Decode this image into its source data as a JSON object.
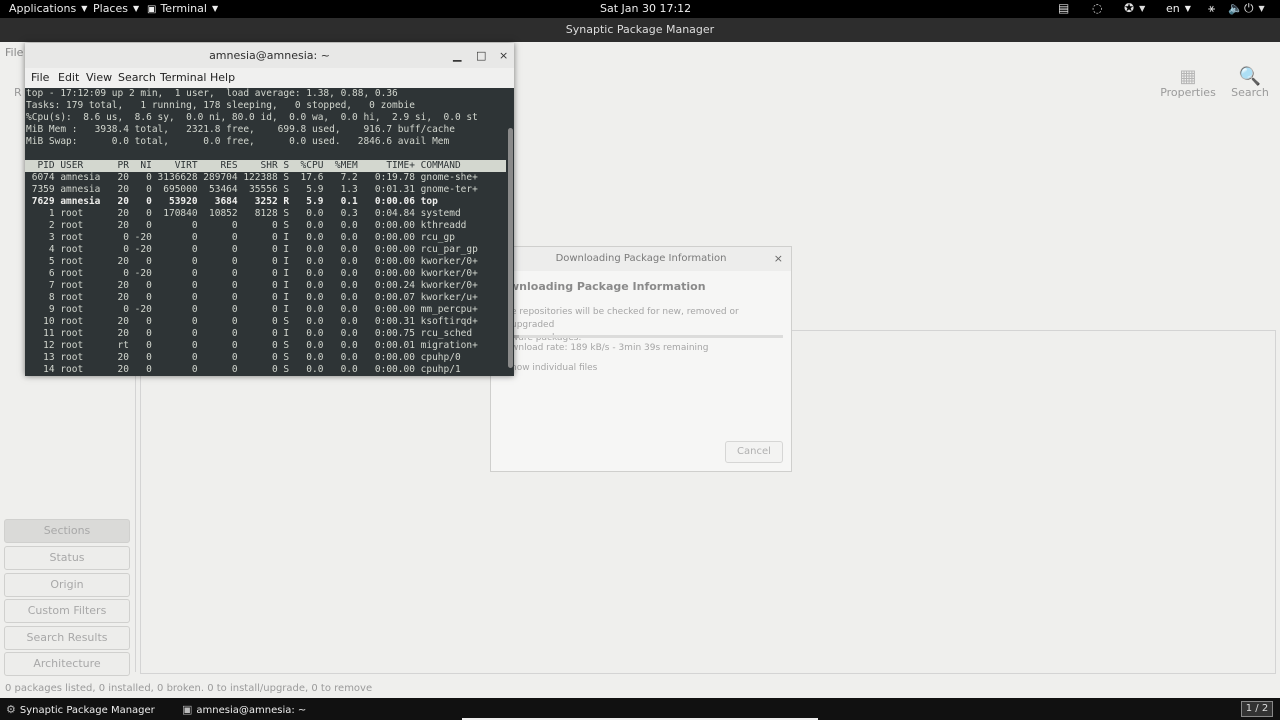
{
  "topbar": {
    "applications": "Applications",
    "places": "Places",
    "terminal": "Terminal",
    "clock": "Sat Jan 30  17:12",
    "language": "en",
    "icons": [
      "clipboard-icon",
      "tor-onion-icon",
      "accessibility-icon",
      "network-icon",
      "sound-icon",
      "power-icon"
    ]
  },
  "synaptic": {
    "title": "Synaptic Package Manager",
    "menu_partial": "File",
    "reload_partial": "R",
    "toolbar": {
      "properties": "Properties",
      "search": "Search"
    },
    "filters": [
      "Sections",
      "Status",
      "Origin",
      "Custom Filters",
      "Search Results",
      "Architecture"
    ],
    "active_filter": "Sections",
    "status_line": "0 packages listed, 0 installed, 0 broken. 0 to install/upgrade, 0 to remove"
  },
  "terminal": {
    "title": "amnesia@amnesia: ~",
    "controls": {
      "minimize": "▁",
      "maximize": "□",
      "close": "×"
    },
    "menu": [
      "File",
      "Edit",
      "View",
      "Search",
      "Terminal",
      "Help"
    ],
    "summary": [
      "top - 17:12:09 up 2 min,  1 user,  load average: 1.38, 0.88, 0.36",
      "Tasks: 179 total,   1 running, 178 sleeping,   0 stopped,   0 zombie",
      "%Cpu(s):  8.6 us,  8.6 sy,  0.0 ni, 80.0 id,  0.0 wa,  0.0 hi,  2.9 si,  0.0 st",
      "MiB Mem :   3938.4 total,   2321.8 free,    699.8 used,    916.7 buff/cache",
      "MiB Swap:      0.0 total,      0.0 free,      0.0 used.   2846.6 avail Mem"
    ],
    "header": "  PID USER      PR  NI    VIRT    RES    SHR S  %CPU  %MEM     TIME+ COMMAND",
    "processes": [
      {
        "line": " 6074 amnesia   20   0 3136628 289704 122388 S  17.6   7.2   0:19.78 gnome-she+",
        "bold": false
      },
      {
        "line": " 7359 amnesia   20   0  695000  53464  35556 S   5.9   1.3   0:01.31 gnome-ter+",
        "bold": false
      },
      {
        "line": " 7629 amnesia   20   0   53920   3684   3252 R   5.9   0.1   0:00.06 top",
        "bold": true
      },
      {
        "line": "    1 root      20   0  170840  10852   8128 S   0.0   0.3   0:04.84 systemd",
        "bold": false
      },
      {
        "line": "    2 root      20   0       0      0      0 S   0.0   0.0   0:00.00 kthreadd",
        "bold": false
      },
      {
        "line": "    3 root       0 -20       0      0      0 I   0.0   0.0   0:00.00 rcu_gp",
        "bold": false
      },
      {
        "line": "    4 root       0 -20       0      0      0 I   0.0   0.0   0:00.00 rcu_par_gp",
        "bold": false
      },
      {
        "line": "    5 root      20   0       0      0      0 I   0.0   0.0   0:00.00 kworker/0+",
        "bold": false
      },
      {
        "line": "    6 root       0 -20       0      0      0 I   0.0   0.0   0:00.00 kworker/0+",
        "bold": false
      },
      {
        "line": "    7 root      20   0       0      0      0 I   0.0   0.0   0:00.24 kworker/0+",
        "bold": false
      },
      {
        "line": "    8 root      20   0       0      0      0 I   0.0   0.0   0:00.07 kworker/u+",
        "bold": false
      },
      {
        "line": "    9 root       0 -20       0      0      0 I   0.0   0.0   0:00.00 mm_percpu+",
        "bold": false
      },
      {
        "line": "   10 root      20   0       0      0      0 S   0.0   0.0   0:00.31 ksoftirqd+",
        "bold": false
      },
      {
        "line": "   11 root      20   0       0      0      0 I   0.0   0.0   0:00.75 rcu_sched",
        "bold": false
      },
      {
        "line": "   12 root      rt   0       0      0      0 S   0.0   0.0   0:00.01 migration+",
        "bold": false
      },
      {
        "line": "   13 root      20   0       0      0      0 S   0.0   0.0   0:00.00 cpuhp/0",
        "bold": false
      },
      {
        "line": "   14 root      20   0       0      0      0 S   0.0   0.0   0:00.00 cpuhp/1",
        "bold": false
      }
    ]
  },
  "dialog": {
    "title": "Downloading Package Information",
    "close": "×",
    "heading": "wnloading Package Information",
    "description": "e repositories will be checked for new, removed or upgraded\nware packages.",
    "progress": 0.03,
    "rate": "wnload rate: 189 kB/s - 3min 39s remaining",
    "show_files": "how individual files",
    "cancel": "Cancel"
  },
  "taskbar": {
    "synaptic": "Synaptic Package Manager",
    "terminal": "amnesia@amnesia: ~",
    "workspace": "1 / 2"
  }
}
